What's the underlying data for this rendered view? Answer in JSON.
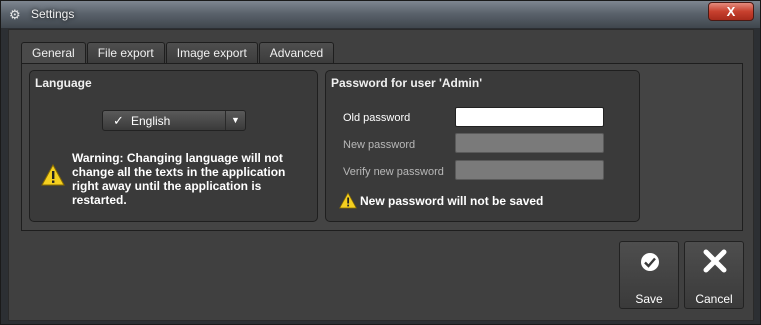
{
  "window": {
    "title": "Settings",
    "close_symbol": "X"
  },
  "tabs": [
    {
      "label": "General",
      "active": true
    },
    {
      "label": "File export",
      "active": false
    },
    {
      "label": "Image export",
      "active": false
    },
    {
      "label": "Advanced",
      "active": false
    }
  ],
  "language": {
    "group_title": "Language",
    "selected": "English",
    "check_mark": "✓",
    "warning": "Warning: Changing language will not change all the texts in the application right away until the application is restarted."
  },
  "password": {
    "group_title": "Password for user 'Admin'",
    "old_label": "Old password",
    "new_label": "New password",
    "verify_label": "Verify new password",
    "old_value": "",
    "new_value": "",
    "verify_value": "",
    "warning": "New password will not be saved"
  },
  "buttons": {
    "save_label": "Save",
    "cancel_label": "Cancel"
  },
  "colors": {
    "warning_yellow": "#f5d020",
    "close_red": "#c7402e",
    "disabled_label": "#b8b8b8"
  }
}
